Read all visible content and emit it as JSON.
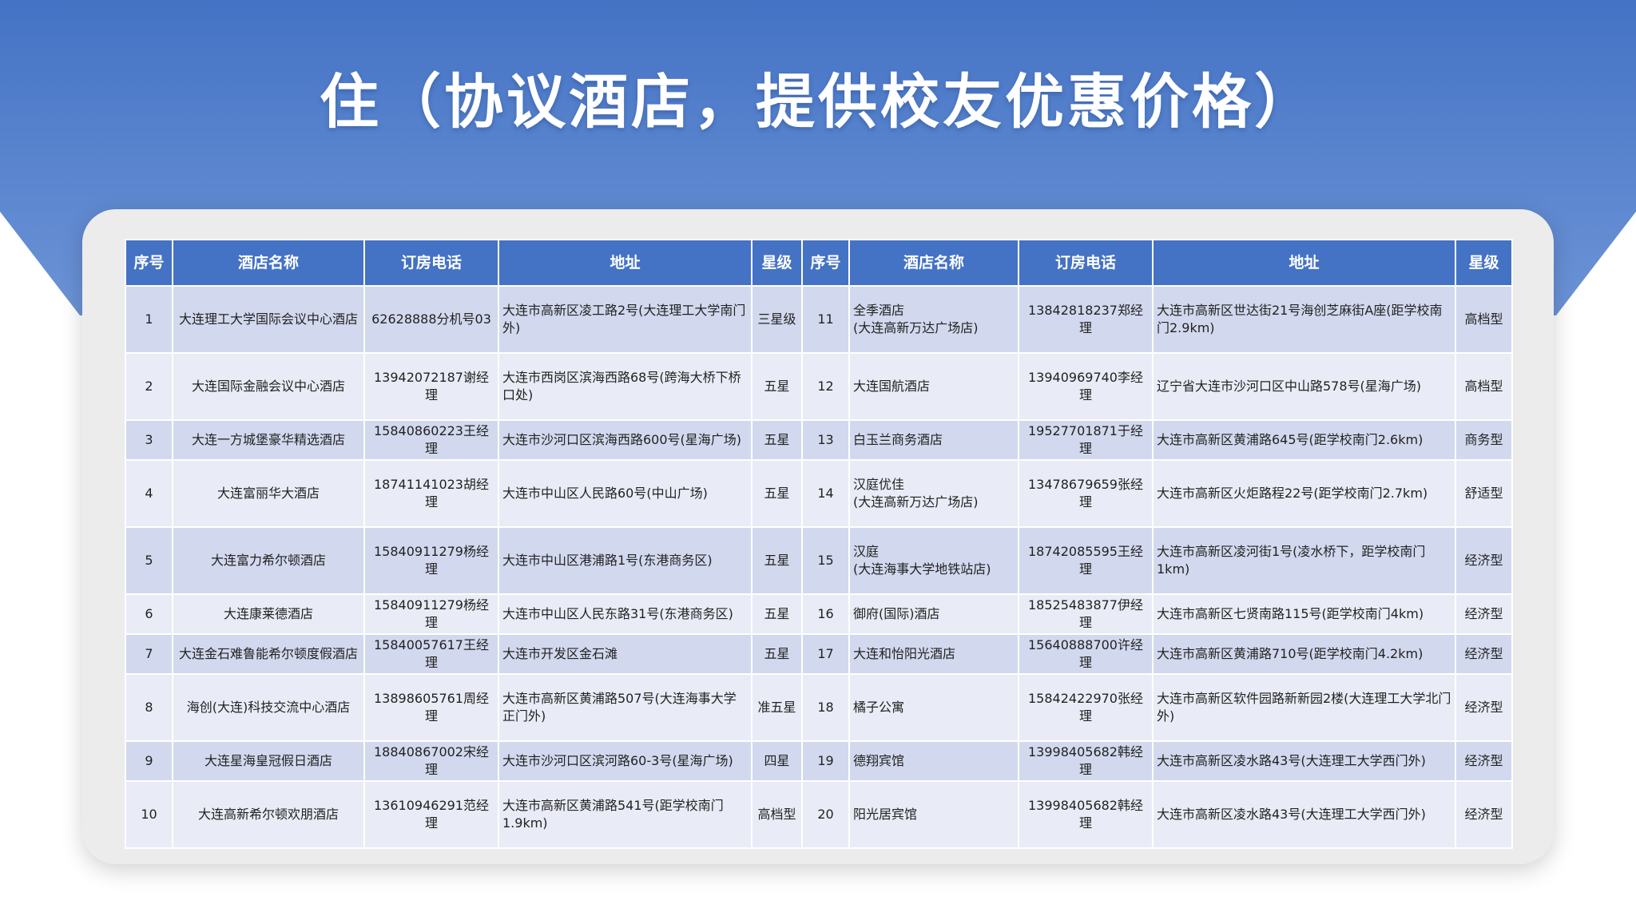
{
  "title": "住（协议酒店，提供校友优惠价格）",
  "colors": {
    "banner": "#4472c4",
    "header": "#4472c4",
    "row_light": "#e9ecf6",
    "row_dark": "#d2d9ee",
    "card": "#ececec"
  },
  "table": {
    "headers": [
      "序号",
      "酒店名称",
      "订房电话",
      "地址",
      "星级",
      "序号",
      "酒店名称",
      "订房电话",
      "地址",
      "星级"
    ],
    "rows": [
      {
        "no_a": "1",
        "name_a": "大连理工大学国际会议中心酒店",
        "phone_a": "62628888分机号03",
        "addr_a": "大连市高新区凌工路2号(大连理工大学南门外)",
        "star_a": "三星级",
        "no_b": "11",
        "name_b": "全季酒店\n(大连高新万达广场店)",
        "phone_b": "13842818237郑经理",
        "addr_b": "大连市高新区世达街21号海创芝麻街A座(距学校南门2.9km)",
        "star_b": "高档型"
      },
      {
        "no_a": "2",
        "name_a": "大连国际金融会议中心酒店",
        "phone_a": "13942072187谢经理",
        "addr_a": "大连市西岗区滨海西路68号(跨海大桥下桥口处)",
        "star_a": "五星",
        "no_b": "12",
        "name_b": "大连国航酒店",
        "phone_b": "13940969740李经理",
        "addr_b": "辽宁省大连市沙河口区中山路578号(星海广场)",
        "star_b": "高档型"
      },
      {
        "no_a": "3",
        "name_a": "大连一方城堡豪华精选酒店",
        "phone_a": "15840860223王经理",
        "addr_a": "大连市沙河口区滨海西路600号(星海广场)",
        "star_a": "五星",
        "no_b": "13",
        "name_b": "白玉兰商务酒店",
        "phone_b": "19527701871于经理",
        "addr_b": "大连市高新区黄浦路645号(距学校南门2.6km)",
        "star_b": "商务型"
      },
      {
        "no_a": "4",
        "name_a": "大连富丽华大酒店",
        "phone_a": "18741141023胡经理",
        "addr_a": "大连市中山区人民路60号(中山广场)",
        "star_a": "五星",
        "no_b": "14",
        "name_b": "汉庭优佳\n(大连高新万达广场店)",
        "phone_b": "13478679659张经理",
        "addr_b": "大连市高新区火炬路程22号(距学校南门2.7km)",
        "star_b": "舒适型"
      },
      {
        "no_a": "5",
        "name_a": "大连富力希尔顿酒店",
        "phone_a": "15840911279杨经理",
        "addr_a": "大连市中山区港浦路1号(东港商务区)",
        "star_a": "五星",
        "no_b": "15",
        "name_b": "汉庭\n(大连海事大学地铁站店)",
        "phone_b": "18742085595王经理",
        "addr_b": "大连市高新区凌河街1号(凌水桥下，距学校南门1km)",
        "star_b": "经济型"
      },
      {
        "no_a": "6",
        "name_a": "大连康莱德酒店",
        "phone_a": "15840911279杨经理",
        "addr_a": "大连市中山区人民东路31号(东港商务区)",
        "star_a": "五星",
        "no_b": "16",
        "name_b": "御府(国际)酒店",
        "phone_b": "18525483877伊经理",
        "addr_b": "大连市高新区七贤南路115号(距学校南门4km)",
        "star_b": "经济型"
      },
      {
        "no_a": "7",
        "name_a": "大连金石难鲁能希尔顿度假酒店",
        "phone_a": "15840057617王经理",
        "addr_a": "大连市开发区金石滩",
        "star_a": "五星",
        "no_b": "17",
        "name_b": "大连和怡阳光酒店",
        "phone_b": "15640888700许经理",
        "addr_b": "大连市高新区黄浦路710号(距学校南门4.2km)",
        "star_b": "经济型"
      },
      {
        "no_a": "8",
        "name_a": "海创(大连)科技交流中心酒店",
        "phone_a": "13898605761周经理",
        "addr_a": "大连市高新区黄浦路507号(大连海事大学正门外)",
        "star_a": "准五星",
        "no_b": "18",
        "name_b": "橘子公寓",
        "phone_b": "15842422970张经理",
        "addr_b": "大连市高新区软件园路新新园2楼(大连理工大学北门外)",
        "star_b": "经济型"
      },
      {
        "no_a": "9",
        "name_a": "大连星海皇冠假日酒店",
        "phone_a": "18840867002宋经理",
        "addr_a": "大连市沙河口区滨河路60-3号(星海广场)",
        "star_a": "四星",
        "no_b": "19",
        "name_b": "德翔宾馆",
        "phone_b": "13998405682韩经理",
        "addr_b": "大连市高新区凌水路43号(大连理工大学西门外)",
        "star_b": "经济型"
      },
      {
        "no_a": "10",
        "name_a": "大连高新希尔顿欢朋酒店",
        "phone_a": "13610946291范经理",
        "addr_a": "大连市高新区黄浦路541号(距学校南门1.9km)",
        "star_a": "高档型",
        "no_b": "20",
        "name_b": "阳光居宾馆",
        "phone_b": "13998405682韩经理",
        "addr_b": "大连市高新区凌水路43号(大连理工大学西门外)",
        "star_b": "经济型"
      }
    ]
  }
}
